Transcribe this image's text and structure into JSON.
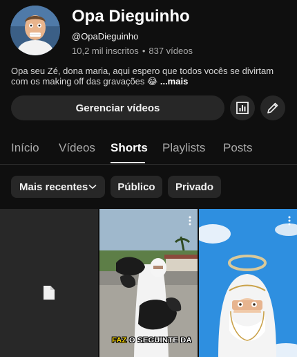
{
  "channel": {
    "name": "Opa Dieguinho",
    "handle": "@OpaDieguinho",
    "subscribers": "10,2 mil inscritos",
    "separator": "•",
    "videos_count": "837 vídeos",
    "description": "Opa seu Zé, dona maria, aqui espero que todos vocês se divirtam com os making off das gravações 😂",
    "more_label": "...mais"
  },
  "actions": {
    "manage_label": "Gerenciar vídeos",
    "analytics_icon": "analytics-icon",
    "edit_icon": "pencil-icon"
  },
  "tabs": [
    {
      "label": "Início",
      "active": false
    },
    {
      "label": "Vídeos",
      "active": false
    },
    {
      "label": "Shorts",
      "active": true
    },
    {
      "label": "Playlists",
      "active": false
    },
    {
      "label": "Posts",
      "active": false
    }
  ],
  "filters": {
    "sort_label": "Mais recentes",
    "public_label": "Público",
    "private_label": "Privado"
  },
  "shorts": [
    {
      "thumbnail": "placeholder-file-icon"
    },
    {
      "caption_highlight": "FAZ",
      "caption_rest": "O SEGUINTE DA"
    },
    {
      "thumbnail": "person-with-halo"
    }
  ],
  "colors": {
    "background": "#0f0f0f",
    "chip": "#272727",
    "secondary_text": "#aaaaaa",
    "caption_highlight": "#f5d300"
  }
}
